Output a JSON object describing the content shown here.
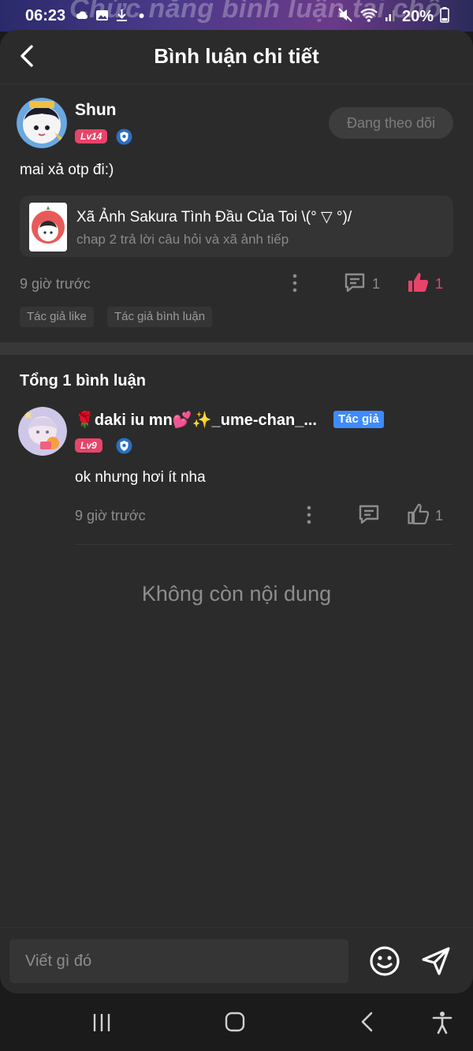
{
  "status_bar": {
    "time": "06:23",
    "battery": "20%",
    "overlay_text": "Chức năng bình luận tại chỗ"
  },
  "header": {
    "title": "Bình luận chi tiết"
  },
  "post": {
    "author": "Shun",
    "level": "Lv14",
    "follow_label": "Đang theo dõi",
    "content": "mai xả otp đi:)",
    "story": {
      "title": "Xã Ảnh Sakura Tình Đầu Của Toi \\(° ▽ °)/",
      "subtitle": "chap 2 trả lời câu hỏi và xã ảnh tiếp"
    },
    "time": "9 giờ trước",
    "comment_count": "1",
    "like_count": "1",
    "tags": [
      "Tác giả like",
      "Tác giả bình luận"
    ]
  },
  "replies": {
    "total_label": "Tổng 1 bình luận",
    "items": [
      {
        "author": "🌹daki iu mn💕✨_ume-chan_...",
        "author_badge": "Tác giả",
        "level": "Lv9",
        "content": "ok nhưng hơi ít nha",
        "time": "9 giờ trước",
        "like_count": "1"
      }
    ],
    "end_text": "Không còn nội dung"
  },
  "composer": {
    "placeholder": "Viết gì đó"
  },
  "colors": {
    "accent_like": "#e8446a",
    "author_badge": "#3d8bfd",
    "level_badge": "#e8446a",
    "sheet_bg": "#2b2b2b"
  },
  "icons": [
    "back-icon",
    "shield-icon",
    "more-icon",
    "comment-icon",
    "like-icon",
    "emoji-icon",
    "send-icon",
    "recents-icon",
    "home-icon",
    "nav-back-icon",
    "accessibility-icon"
  ]
}
